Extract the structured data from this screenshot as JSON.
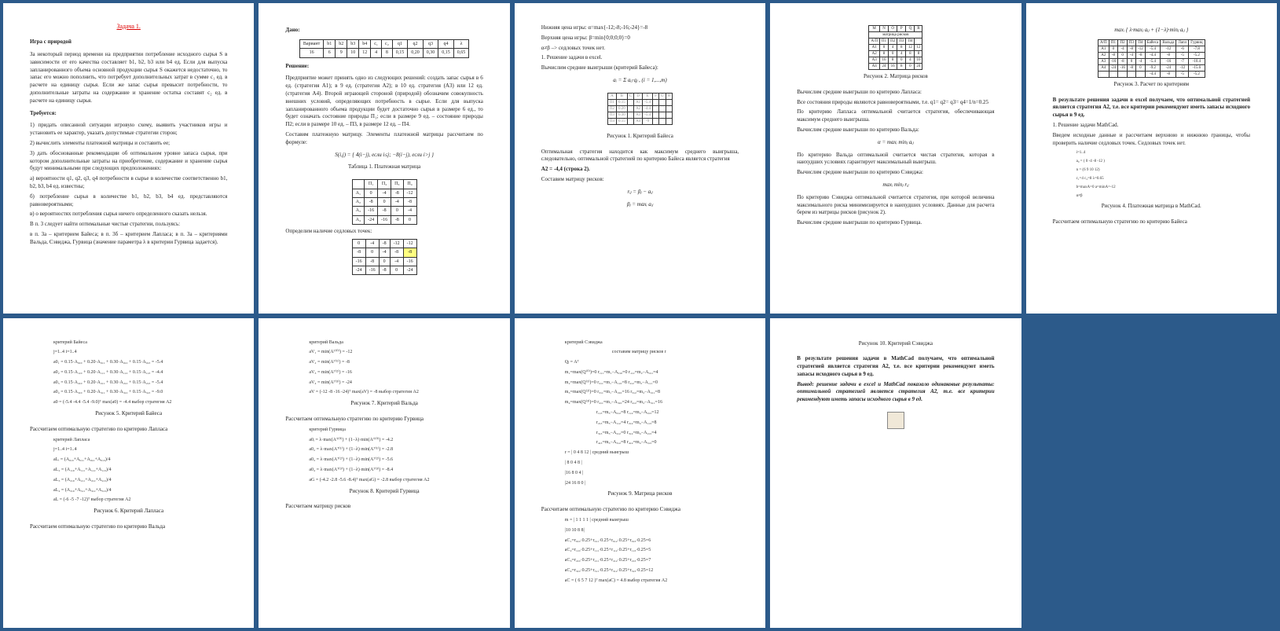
{
  "page1": {
    "title": "Задача 1.",
    "subtitle": "Игра с природой",
    "para1": "За некоторый период времени на предприятии потребление исходного сырья S в зависимости от его качества составляет b1, b2, b3 или b4 ед. Если для выпуска запланированного объема основной продукции сырья S окажется недостаточно, то запас его можно пополнить, что потребует дополнительных затрат в сумме c₁ ед. в расчете на единицу сырья. Если же запас сырья превысит потребности, то дополнительные затраты на содержание и хранение остатка составят c₂ ед. в расчете на единицу сырья.",
    "treb": "Требуется:",
    "t1": "1) придать описанной ситуации игровую схему, выявить участников игры и установить ее характер, указать допустимые стратегии сторон;",
    "t2": "2) вычислить элементы платежной матрицы и составить ее;",
    "t3": "3) дать обоснованные рекомендации об оптимальном уровне запаса сырья, при котором дополнительные затраты на приобретение, содержание и хранение сырья будут минимальными при следующих предположениях:",
    "a": "а) вероятности q1, q2, q3, q4 потребности в сырье в количестве соответственно b1, b2, b3, b4 ед. известны;",
    "b": "б) потребление сырья в количестве b1, b2, b3, b4 ед. представляются равновероятными;",
    "v": "в) о вероятностях потребления сырья ничего определенного сказать нельзя.",
    "p3": "В п. 3 следует найти оптимальные чистые стратегии, пользуясь:",
    "p3a": "в п. 3а – критерием Байеса; в п. 3б – критерием Лапласа; в п. 3а – критериями Вальда, Сэвиджа, Гурвица (значение параметра λ в критерии Гурвица задается)."
  },
  "page2": {
    "dano": "Дано:",
    "headers": [
      "Вариант",
      "b1",
      "b2",
      "b3",
      "b4",
      "c₁",
      "c₂",
      "q1",
      "q2",
      "q3",
      "q4",
      "λ"
    ],
    "row": [
      "16",
      "6",
      "9",
      "10",
      "12",
      "4",
      "8",
      "0,15",
      "0,20",
      "0,30",
      "0,15",
      "0,65"
    ],
    "reshenie": "Решение:",
    "para": "Предприятие может принять одно из следующих решений: создать запас сырья в 6 ед. (стратегия A1); в 9 ед. (стратегия A2); в 10 ед. стратегия (A3) или 12 ед. (стратегия A4). Второй играющей стороной (природой) обозначим совокупность внешних условий, определяющих потребность в сырье. Если для выпуска запланированного объема продукции будет достаточно сырья в размере 6 ед., то будет означать состояние природы П₁; если в размере 9 ед. – состояние природы П2; если в размере 10 ед. – П3, в размере 12 ед. – П4.",
    "para2": "Составим платежную матрицу. Элементы платежной матрицы рассчитаем по формуле:",
    "formula": "S(i,j) = { 4(i−j), если i≤j;  −8(i−j), если i>j }",
    "tcaption": "Таблица 1. Платежная матрица",
    "mhead": [
      "",
      "П₁",
      "П₂",
      "П₃",
      "П₄"
    ],
    "mrow1": [
      "A₁",
      "0",
      "-4",
      "-8",
      "-12"
    ],
    "mrow2": [
      "A₂",
      "-8",
      "0",
      "-4",
      "-8"
    ],
    "mrow3": [
      "A₃",
      "-16",
      "-8",
      "0",
      "-4"
    ],
    "mrow4": [
      "A₄",
      "-24",
      "-16",
      "-8",
      "0"
    ],
    "sedl": "Определим наличие седловых точек:",
    "s1": [
      "0",
      "-4",
      "-8",
      "-12",
      "-12"
    ],
    "s2": [
      "-8",
      "0",
      "-4",
      "-8",
      "-8"
    ],
    "s3": [
      "-16",
      "-8",
      "0",
      "-4",
      "-16"
    ],
    "s4": [
      "-24",
      "-16",
      "-8",
      "0",
      "-24"
    ]
  },
  "page3": {
    "l1": "Нижняя цена игры: α=max{-12;-8;-16;-24}=-8",
    "l2": "Верхняя цена игры: β=min{0;0;0;0}=0",
    "l3": "α≠β –> седловых точек нет.",
    "step1": "1.     Решение задачи в excel.",
    "step1a": "Вычислим средние выигрыши (критерий Байеса):",
    "aformula": "aᵢ = Σ aᵢⱼ·qⱼ ,  (i = 1,...,m)",
    "figcap": "Рисунок 1. Критерий Байеса",
    "para2": "Оптимальная стратегия находится как максимум среднего выигрыша, следовательно, оптимальной стратегией по критерию Байеса является стратегия",
    "result": "А2 = -4,4 (строка 2).",
    "sostav": "Составим матрицу рисков:",
    "rf1": "rᵢⱼ = βⱼ − aᵢⱼ",
    "rf2": "βⱼ = maxᵢ aᵢⱼ"
  },
  "page4": {
    "h1": [
      "",
      "M",
      "N",
      "O",
      "P",
      "Q",
      "R"
    ],
    "h2": [
      "",
      "матрица рисков",
      "",
      "",
      "",
      "",
      ""
    ],
    "r0": [
      "",
      "A/П",
      "П1",
      "П2",
      "П3",
      "П4",
      ""
    ],
    "r1": [
      "",
      "A1",
      "0",
      "4",
      "8",
      "12",
      "12"
    ],
    "r2": [
      "",
      "A2",
      "8",
      "0",
      "4",
      "8",
      "8"
    ],
    "r3": [
      "",
      "A3",
      "16",
      "8",
      "0",
      "4",
      "16"
    ],
    "r4": [
      "",
      "A4",
      "24",
      "16",
      "8",
      "0",
      "24"
    ],
    "figcap": "Рисунок 2. Матрица рисков",
    "p1": "Вычислим средние выигрыши по критерию Лапласа:",
    "p1a": "Все состояния природы являются равновероятными, т.е. q1= q2= q3= q4=1/n=0.25",
    "p2": "По критерию Лапласа оптимальной считается стратегия, обеспечивающая максимум среднего выигрыша.",
    "p3": "Вычислим средние выигрыши по критерию Вальда:",
    "wald": "α = maxᵢ minⱼ aᵢⱼ",
    "p4": "По критерию Вальда оптимальной считается чистая стратегия, которая в наихудших условиях гарантирует максимальный выигрыш.",
    "p5": "Вычислим средние выигрыши по критерию Сэвиджа:",
    "sev": "maxᵢ minⱼ rᵢⱼ",
    "p6": "По критерию Сэвиджа оптимальной считается стратегия, при которой величина максимального риска минимизируется в наихудших условиях. Данные для расчета берем из матрицы рисков (рисунок 2).",
    "p7": "Вычислим средние выигрыши по критерию Гурвица."
  },
  "page5": {
    "top": "maxᵢ { λ·maxⱼ aᵢⱼ + (1−λ)·minⱼ aᵢⱼ }",
    "thead": [
      "",
      "A/П",
      "П1",
      "П2",
      "П3",
      "П4",
      "Байеса",
      "Вальда",
      "Лапл",
      "Гурвиц"
    ],
    "r1": [
      "",
      "A1",
      "0",
      "-4",
      "-8",
      "-12",
      "-5.4",
      "-12",
      "-6",
      "-7.8"
    ],
    "r2": [
      "",
      "A2",
      "-8",
      "0",
      "-4",
      "-8",
      "-4.4",
      "-8",
      "-5",
      "-5.2"
    ],
    "r3": [
      "",
      "A3",
      "-16",
      "-8",
      "0",
      "-4",
      "-5.4",
      "-16",
      "-7",
      "-10.4"
    ],
    "r4": [
      "",
      "A4",
      "-24",
      "-16",
      "-8",
      "0",
      "-9.2",
      "-24",
      "-12",
      "-15.6"
    ],
    "r5": [
      "",
      "",
      "",
      "",
      "",
      "",
      "-4.4",
      "-8",
      "-5",
      "-5.2"
    ],
    "figcap": "Рисунок 3. Расчет по критериям",
    "bold1": "В результате решения задачи в excel получаем, что оптимальной стратегией является стратегия А2, т.е. все критерии рекомендуют иметь запасы исходного сырья в 9   ед.",
    "step2h": "1. Решение задачи MathCad.",
    "s1": "Введем исходные данные и рассчитаем верхнюю и нижнюю границы, чтобы проверить наличие седловых точек. Седловых точек нет.",
    "fig4": "Рисунок 4. Платежная матрица в MathCad.",
    "last": "Рассчитаем оптимальную стратегию по критерию Байеса"
  },
  "page6": {
    "hdr": "критерий Байеса",
    "l0": "j=1..4   i=1..4",
    "l1": "а0₁ = 0.15·A₀,₀ + 0.20·A₀,₁ + 0.30·A₀,₂ + 0.15·A₀,₃ = -5.4",
    "l2": "а0₂ = 0.15·A₁,₀ + 0.20·A₁,₁ + 0.30·A₁,₂ + 0.15·A₁,₃ = -4.4",
    "l3": "а0₃ = 0.15·A₂,₀ + 0.20·A₂,₁ + 0.30·A₂,₂ + 0.15·A₂,₃ = -5.4",
    "l4": "а0₄ = 0.15·A₃,₀ + 0.20·A₃,₁ + 0.30·A₃,₂ + 0.15·A₃,₃ = -9.0",
    "mat": "а0 = (-5.4  -4.4  -5.4  -9.0)ᵀ    max(а0) = -4.4   выбор стратегия A2",
    "fig5": "Рисунок 5. Критерий Байеса",
    "para": "Рассчитаем оптимальную стратегию по критерию Лапласа",
    "hdr2": "критерий Лапласа",
    "ll1": "aLᵢ = (A₀,₀+A₀,₁+A₀,₂+A₀,₃)/4",
    "ll2": "aL₂ = (A₁,₀+A₁,₁+A₁,₂+A₁,₃)/4",
    "ll3": "aL₃ = (A₂,₀+A₂,₁+A₂,₂+A₂,₃)/4",
    "ll4": "aL₄ = (A₃,₀+A₃,₁+A₃,₂+A₃,₃)/4",
    "lmat": "aL = (-6  -5  -7  -12)ᵀ   выбор стратегия A2",
    "fig6": "Рисунок 6. Критерий Лапласа",
    "last": "Рассчитаем оптимальную стратегию по критерию Вальда"
  },
  "page7": {
    "hdr": "критерий Вальда",
    "l1": "аV₁ = min(Aᵀ⁽⁰⁾) = -12",
    "l2": "аV₂ = min(Aᵀ⁽¹⁾) = -8",
    "l3": "аV₃ = min(Aᵀ⁽²⁾) = -16",
    "l4": "аV₄ = min(Aᵀ⁽³⁾) = -24",
    "mat": "aV = (-12  -8  -16  -24)ᵀ    max(aV) = -8   выбор стратегия A2",
    "fig7": "Рисунок 7. Критерий Вальда",
    "para": "Рассчитаем оптимальную стратегию по критерию Гурвица",
    "hdr2": "критерий Гурвица",
    "g1": "а0ᵢ = λ·max(Aᵀ⁽⁰⁾) + (1−λ)·min(Aᵀ⁽⁰⁾) = -4.2",
    "g2": "а0₂ = λ·max(Aᵀ⁽¹⁾) + (1−λ)·min(Aᵀ⁽¹⁾) = -2.8",
    "g3": "а0₃ = λ·max(Aᵀ⁽²⁾) + (1−λ)·min(Aᵀ⁽²⁾) = -5.6",
    "g4": "а0₄ = λ·max(Aᵀ⁽³⁾) + (1−λ)·min(Aᵀ⁽³⁾) = -8.4",
    "gmat": "aG = (-4.2  -2.8  -5.6  -8.4)ᵀ   max(aG) = -2.8   выбор стратегия A2",
    "fig8": "Рисунок 8. Критерий Гурвица",
    "last": "Рассчитаем матрицу рисков"
  },
  "page8": {
    "hdr": "критерий Сэвиджа",
    "subhdr": "составим матрицу рисков r",
    "qa": "Qⱼ = Aᵀ",
    "m1": "m₁=max(Q⁽⁰⁾)=0   r₁,₁=m₁−A₀,₀=0   r₁,₂=m₂−A₀,₁=4",
    "m2": "m₂=max(Q⁽¹⁾)=0   r₂,₁=m₁−A₁,₀=8   r₂,₂=m₂−A₁,₁=0",
    "m3": "m₃=max(Q⁽²⁾)=0   r₃,₁=m₁−A₂,₀=16  r₃,₂=m₂−A₂,₁=8",
    "m4": "m₄=max(Q⁽³⁾)=0   r₄,₁=m₁−A₃,₀=24  r₄,₂=m₂−A₃,₁=16",
    "rr": "r₁,₃=m₃−A₀,₂=8   r₁,₄=m₄−A₀,₃=12",
    "rr2": "r₂,₃=m₃−A₁,₂=4   r₂,₄=m₄−A₁,₃=8",
    "rr3": "r₃,₃=m₃−A₂,₂=0   r₃,₄=m₄−A₂,₃=4",
    "rr4": "r₄,₃=m₃−A₃,₂=8   r₄,₄=m₄−A₃,₃=0",
    "rmat": "r = | 0  4  8 12 |   средний выигрыш",
    "rmat2": "    | 8  0  4  8 |",
    "rmat3": "    |16  8  0  4 |",
    "rmat4": "    |24 16  8  0 |",
    "fig9": "Рисунок 9. Матрица рисков",
    "para": "Рассчитаем оптимальную стратегию по критерию Сэвиджа",
    "bm": "m = | 1  1  1  1 |    средний выигрыш",
    "bm2": "    |10  10  8  8|",
    "c1": "aC₁=r₀,₀·0.25+r₀,₁·0.25+r₀,₂·0.25+r₀,₃·0.25=6",
    "c2": "aC₂=r₁,₀·0.25+r₁,₁·0.25+r₁,₂·0.25+r₁,₃·0.25=5",
    "c3": "aC₃=r₂,₀·0.25+r₂,₁·0.25+r₂,₂·0.25+r₂,₃·0.25=7",
    "c4": "aC₄=r₃,₀·0.25+r₃,₁·0.25+r₃,₂·0.25+r₃,₃·0.25=12",
    "cmat": "aC = ( 6  5  7 12 )ᵀ    max(aC) = 4.8   выбор стратегия A2"
  },
  "page9": {
    "fig10": "Рисунок 10. Критерий Сэвиджа",
    "b1": "В результате решения задачи в MathCad получаем, что оптимальной стратегией является стратегия А2, т.е. все критерии рекомендуют иметь запасы исходного сырья в 9 ед.",
    "b2": "Вывод: решение задачи в excel и MathCad показало одинаковые результаты: оптимальной стратегией является стратегия А2, т.е. все критерии рекомендуют иметь запасы исходного сырья в 9 ед."
  }
}
